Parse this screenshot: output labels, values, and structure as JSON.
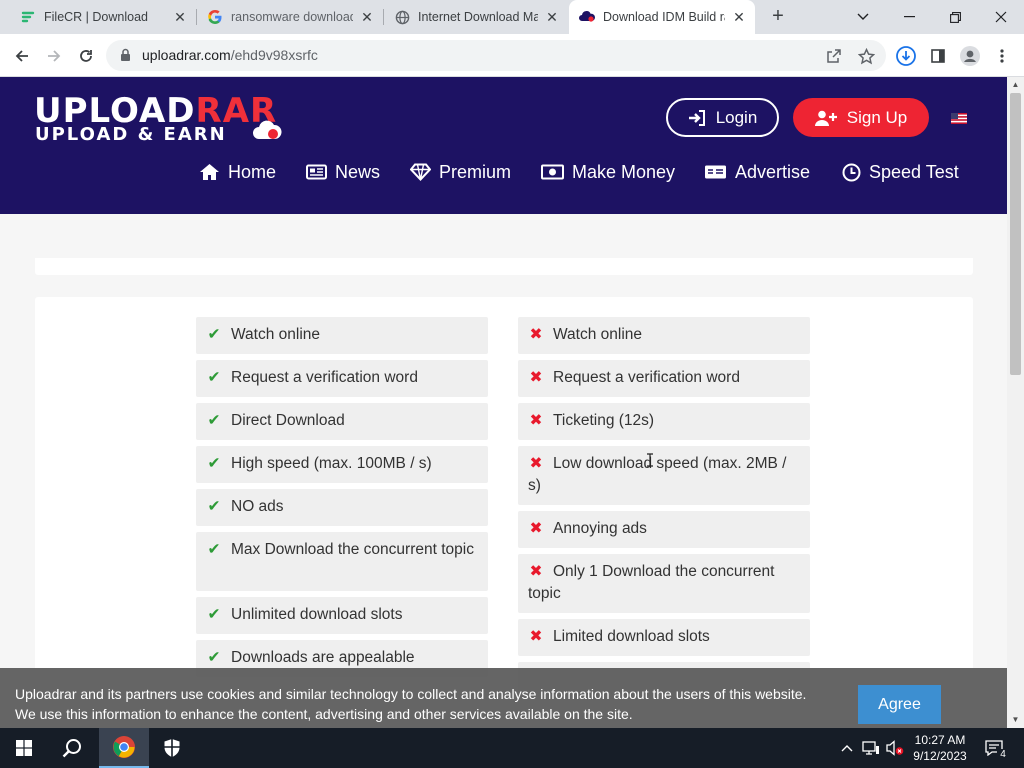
{
  "tabs": [
    {
      "title": "FileCR | Download",
      "favicon": "filecr-icon"
    },
    {
      "title": "ransomware download",
      "favicon": "google-icon"
    },
    {
      "title": "Internet Download Ma",
      "favicon": "globe-icon"
    },
    {
      "title": "Download IDM Build ra",
      "favicon": "uploadrar-icon",
      "active": true
    }
  ],
  "address_bar": {
    "domain": "uploadrar.com",
    "path": "/ehd9v98xsrfc"
  },
  "site": {
    "logo_top_white": "UPLOAD",
    "logo_top_red": "RAR",
    "logo_bottom": "UPLOAD & EARN",
    "login_label": "Login",
    "signup_label": "Sign Up",
    "nav": {
      "home": "Home",
      "news": "News",
      "premium": "Premium",
      "make_money": "Make Money",
      "advertise": "Advertise",
      "speed_test": "Speed Test"
    }
  },
  "premium_features": [
    "Watch online",
    "Request a verification word",
    "Direct Download",
    "High speed (max. 100MB / s)",
    "NO ads",
    "Max Download the concurrent topic",
    "Unlimited download slots",
    "Downloads are appealable"
  ],
  "free_features": [
    "Watch online",
    "Request a verification word",
    "Ticketing (12s)",
    "Low download speed (max. 2MB / s)",
    "Annoying ads",
    "Only 1 Download the concurrent topic",
    "Limited download slots"
  ],
  "cookie": {
    "line1": "Uploadrar and its partners use cookies and similar technology to collect and analyse information about the users of this website.",
    "line2": "We use this information to enhance the content, advertising and other services available on the site.",
    "agree_label": "Agree"
  },
  "taskbar": {
    "time": "10:27 AM",
    "date": "9/12/2023",
    "notifications": "4"
  },
  "colors": {
    "header_bg": "#1d1263",
    "accent_red": "#ee2433",
    "check_green": "#2e9b37",
    "cross_red": "#e8192c",
    "agree_blue": "#3d8fd1"
  }
}
